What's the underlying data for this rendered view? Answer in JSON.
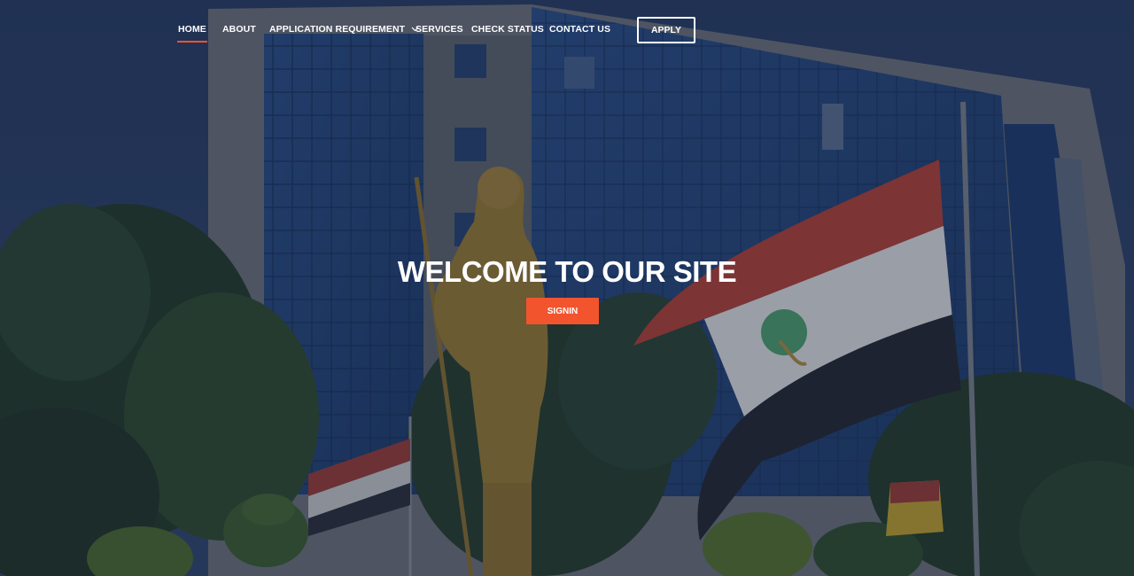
{
  "nav": {
    "items": [
      {
        "label": "HOME",
        "active": true
      },
      {
        "label": "ABOUT"
      },
      {
        "label": "APPLICATION REQUIREMENT",
        "has_dropdown": true
      },
      {
        "label": "SERVICES"
      },
      {
        "label": "CHECK STATUS"
      },
      {
        "label": "CONTACT US"
      }
    ],
    "apply_label": "APPLY"
  },
  "hero": {
    "title": "WELCOME TO OUR SITE",
    "signin_label": "SIGNIN"
  },
  "colors": {
    "accent": "#f2542d",
    "nav_text": "#ffffff",
    "overlay": "#142038"
  },
  "icons": {
    "dropdown": "chevron-down-icon"
  }
}
